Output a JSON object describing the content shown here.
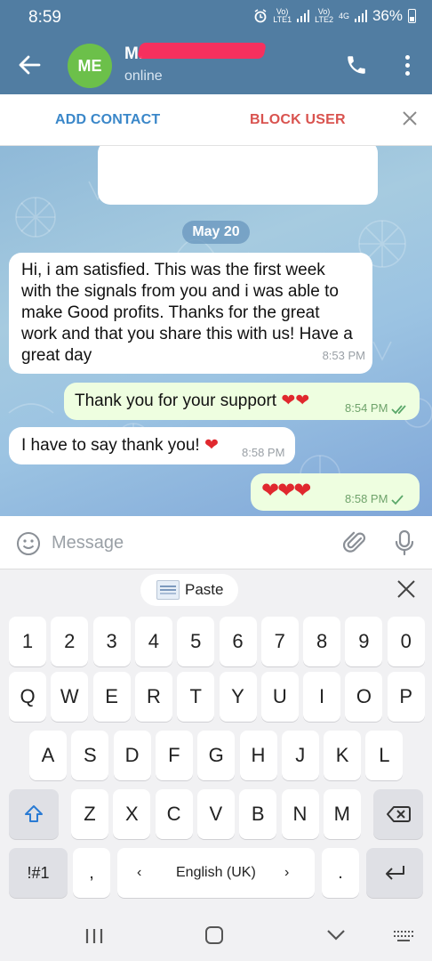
{
  "status_bar": {
    "time": "8:59",
    "sim1_label": "VoLTE1",
    "sim2_label": "VoLTE2",
    "network": "4G",
    "battery": "36%"
  },
  "header": {
    "avatar_initials": "ME",
    "avatar_color": "#6cc04a",
    "contact_name": "M.",
    "status": "online",
    "bar_color": "#517da2"
  },
  "action_bar": {
    "add_contact": "ADD CONTACT",
    "block_user": "BLOCK USER"
  },
  "chat": {
    "date": "May 20",
    "messages": [
      {
        "direction": "in",
        "text": "Hi, i am satisfied. This was the first week with the signals from you and i was able to make Good profits. Thanks for the great work and that you share this with us! Have a great day",
        "time": "8:53 PM"
      },
      {
        "direction": "out",
        "text": "Thank you for your support",
        "emoji": "❤❤",
        "time": "8:54 PM",
        "ticks": "read"
      },
      {
        "direction": "in",
        "text": "I have to say thank you!",
        "emoji": "❤",
        "time": "8:58 PM"
      },
      {
        "direction": "out",
        "text": "",
        "emoji": "❤❤❤",
        "time": "8:58 PM",
        "ticks": "sent"
      }
    ]
  },
  "composer": {
    "placeholder": "Message"
  },
  "keyboard": {
    "paste_label": "Paste",
    "row_numbers": [
      "1",
      "2",
      "3",
      "4",
      "5",
      "6",
      "7",
      "8",
      "9",
      "0"
    ],
    "row_q": [
      "Q",
      "W",
      "E",
      "R",
      "T",
      "Y",
      "U",
      "I",
      "O",
      "P"
    ],
    "row_a": [
      "A",
      "S",
      "D",
      "F",
      "G",
      "H",
      "J",
      "K",
      "L"
    ],
    "row_z": [
      "Z",
      "X",
      "C",
      "V",
      "B",
      "N",
      "M"
    ],
    "symbols_key": "!#1",
    "comma_key": ",",
    "period_key": ".",
    "language_left": "‹",
    "language": "English (UK)",
    "language_right": "›"
  },
  "icons": {
    "back": "back-arrow-icon",
    "call": "phone-icon",
    "menu": "more-vert-icon",
    "close": "close-icon",
    "emoji": "emoji-icon",
    "attach": "paperclip-icon",
    "mic": "microphone-icon",
    "shift": "shift-icon",
    "backspace": "backspace-icon",
    "enter": "enter-icon"
  }
}
